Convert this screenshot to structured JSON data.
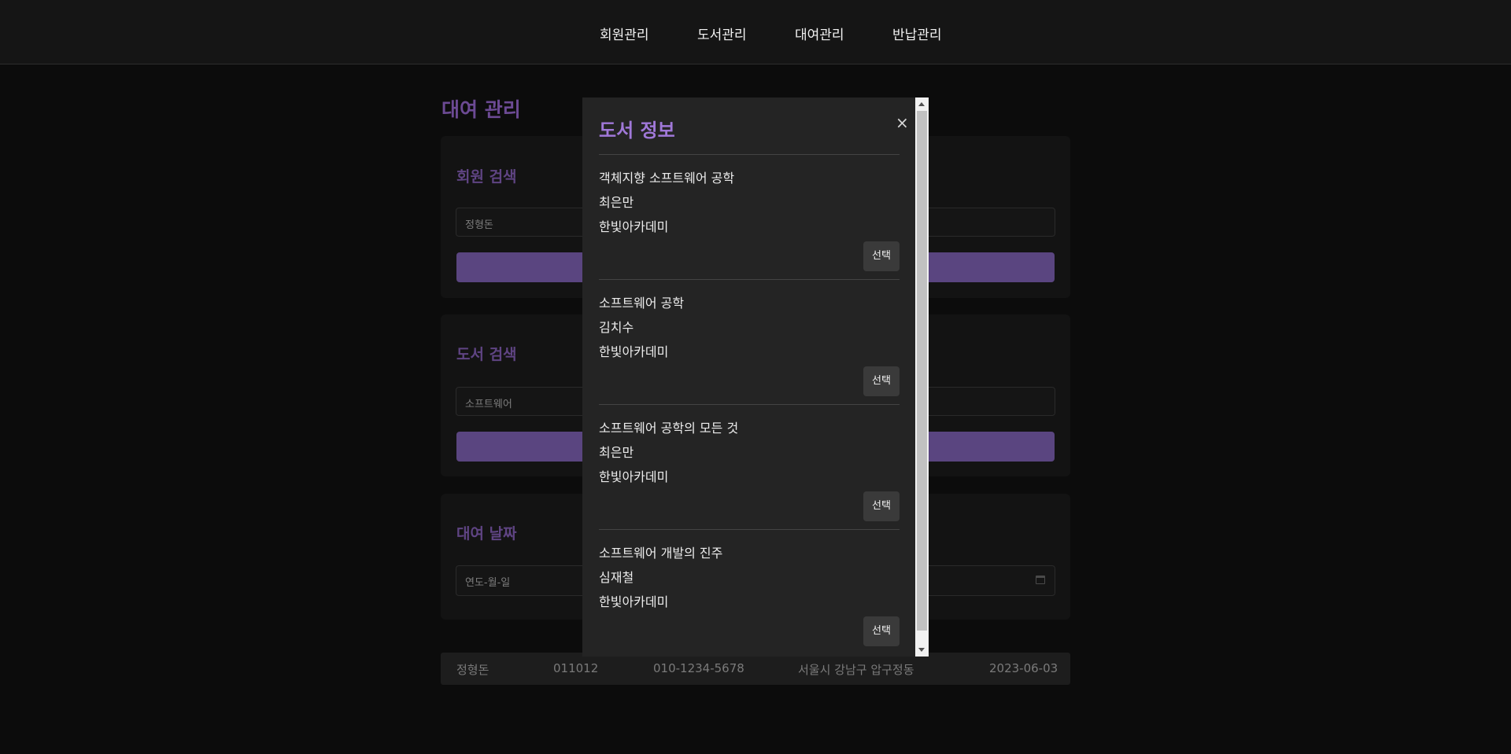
{
  "nav": {
    "items": [
      "회원관리",
      "도서관리",
      "대여관리",
      "반납관리"
    ]
  },
  "page": {
    "title": "대여 관리"
  },
  "member_search": {
    "title": "회원 검색",
    "value": "정형돈"
  },
  "book_search": {
    "title": "도서 검색",
    "value": "소프트웨어"
  },
  "rental_date": {
    "title": "대여 날짜",
    "placeholder": "연도-월-일"
  },
  "summary": {
    "name": "정형돈",
    "id": "011012",
    "phone": "010-1234-5678",
    "address": "서울시 강남구 압구정동",
    "date": "2023-06-03"
  },
  "modal": {
    "title": "도서 정보",
    "close": "×",
    "select_label": "선택",
    "books": [
      {
        "title": "객체지향 소프트웨어 공학",
        "author": "최은만",
        "publisher": "한빛아카데미"
      },
      {
        "title": "소프트웨어 공학",
        "author": "김치수",
        "publisher": "한빛아카데미"
      },
      {
        "title": "소프트웨어 공학의 모든 것",
        "author": "최은만",
        "publisher": "한빛아카데미"
      },
      {
        "title": "소프트웨어 개발의 진주",
        "author": "심재철",
        "publisher": "한빛아카데미"
      }
    ]
  },
  "colors": {
    "accent": "#a078d8",
    "button": "#5a4580",
    "background": "#0c0c0c",
    "modal_bg": "#242424"
  }
}
